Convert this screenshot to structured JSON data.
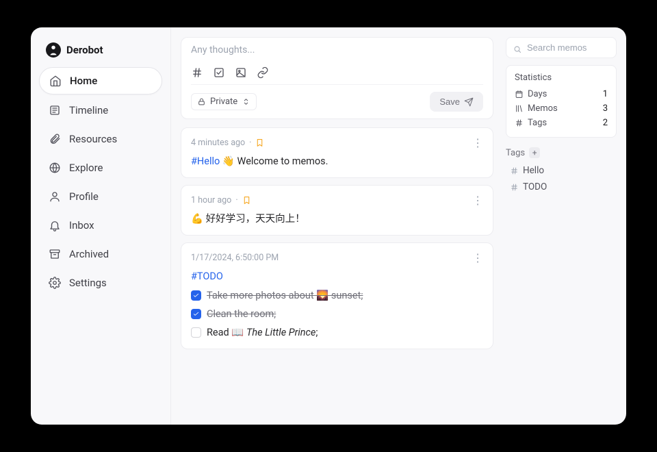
{
  "brand": {
    "name": "Derobot"
  },
  "nav": {
    "home": "Home",
    "timeline": "Timeline",
    "resources": "Resources",
    "explore": "Explore",
    "profile": "Profile",
    "inbox": "Inbox",
    "archived": "Archived",
    "settings": "Settings"
  },
  "composer": {
    "placeholder": "Any thoughts...",
    "visibility": "Private",
    "save": "Save"
  },
  "memos": [
    {
      "time": "4 minutes ago",
      "bookmarked": true,
      "tag": "#Hello",
      "text_after_tag": " 👋 Welcome to memos."
    },
    {
      "time": "1 hour ago",
      "bookmarked": true,
      "text": "💪 好好学习，天天向上！"
    },
    {
      "time": "1/17/2024, 6:50:00 PM",
      "bookmarked": false,
      "tag": "#TODO",
      "todos": [
        {
          "done": true,
          "text": "Take more photos about 🌄 sunset;"
        },
        {
          "done": true,
          "text": "Clean the room;"
        },
        {
          "done": false,
          "prefix": "Read 📖 ",
          "italic": "The Little Prince",
          "suffix": ";"
        }
      ]
    }
  ],
  "search": {
    "placeholder": "Search memos"
  },
  "statistics": {
    "title": "Statistics",
    "days_label": "Days",
    "days_value": "1",
    "memos_label": "Memos",
    "memos_value": "3",
    "tags_label": "Tags",
    "tags_value": "2"
  },
  "tags": {
    "title": "Tags",
    "items": [
      "Hello",
      "TODO"
    ]
  }
}
